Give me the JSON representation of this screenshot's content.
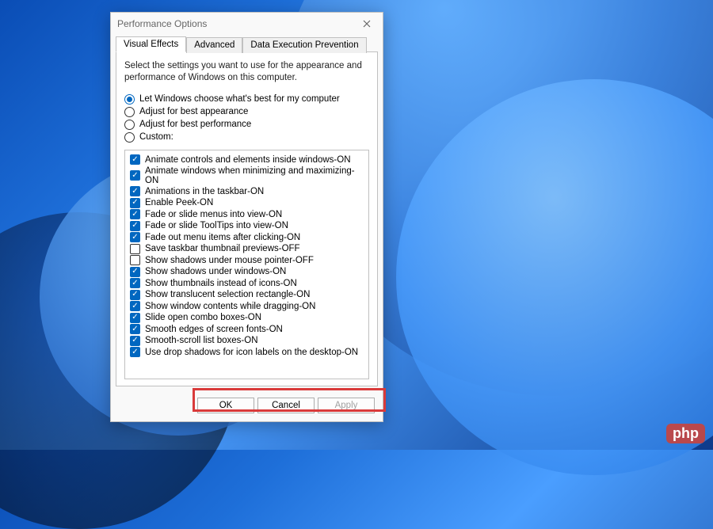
{
  "dialog": {
    "title": "Performance Options",
    "tabs": [
      {
        "label": "Visual Effects",
        "active": true
      },
      {
        "label": "Advanced",
        "active": false
      },
      {
        "label": "Data Execution Prevention",
        "active": false
      }
    ],
    "description": "Select the settings you want to use for the appearance and performance of Windows on this computer.",
    "radios": [
      {
        "label": "Let Windows choose what's best for my computer",
        "checked": true
      },
      {
        "label": "Adjust for best appearance",
        "checked": false
      },
      {
        "label": "Adjust for best performance",
        "checked": false
      },
      {
        "label": "Custom:",
        "checked": false
      }
    ],
    "effects": [
      {
        "label": "Animate controls and elements inside windows-ON",
        "checked": true
      },
      {
        "label": "Animate windows when minimizing and maximizing-ON",
        "checked": true
      },
      {
        "label": "Animations in the taskbar-ON",
        "checked": true
      },
      {
        "label": "Enable Peek-ON",
        "checked": true
      },
      {
        "label": "Fade or slide menus into view-ON",
        "checked": true
      },
      {
        "label": "Fade or slide ToolTips into view-ON",
        "checked": true
      },
      {
        "label": "Fade out menu items after clicking-ON",
        "checked": true
      },
      {
        "label": "Save taskbar thumbnail previews-OFF",
        "checked": false
      },
      {
        "label": "Show shadows under mouse pointer-OFF",
        "checked": false
      },
      {
        "label": "Show shadows under windows-ON",
        "checked": true
      },
      {
        "label": "Show thumbnails instead of icons-ON",
        "checked": true
      },
      {
        "label": "Show translucent selection rectangle-ON",
        "checked": true
      },
      {
        "label": "Show window contents while dragging-ON",
        "checked": true
      },
      {
        "label": "Slide open combo boxes-ON",
        "checked": true
      },
      {
        "label": "Smooth edges of screen fonts-ON",
        "checked": true
      },
      {
        "label": "Smooth-scroll list boxes-ON",
        "checked": true
      },
      {
        "label": "Use drop shadows for icon labels on the desktop-ON",
        "checked": true
      }
    ],
    "buttons": {
      "ok": "OK",
      "cancel": "Cancel",
      "apply": "Apply"
    }
  },
  "watermark": "php"
}
